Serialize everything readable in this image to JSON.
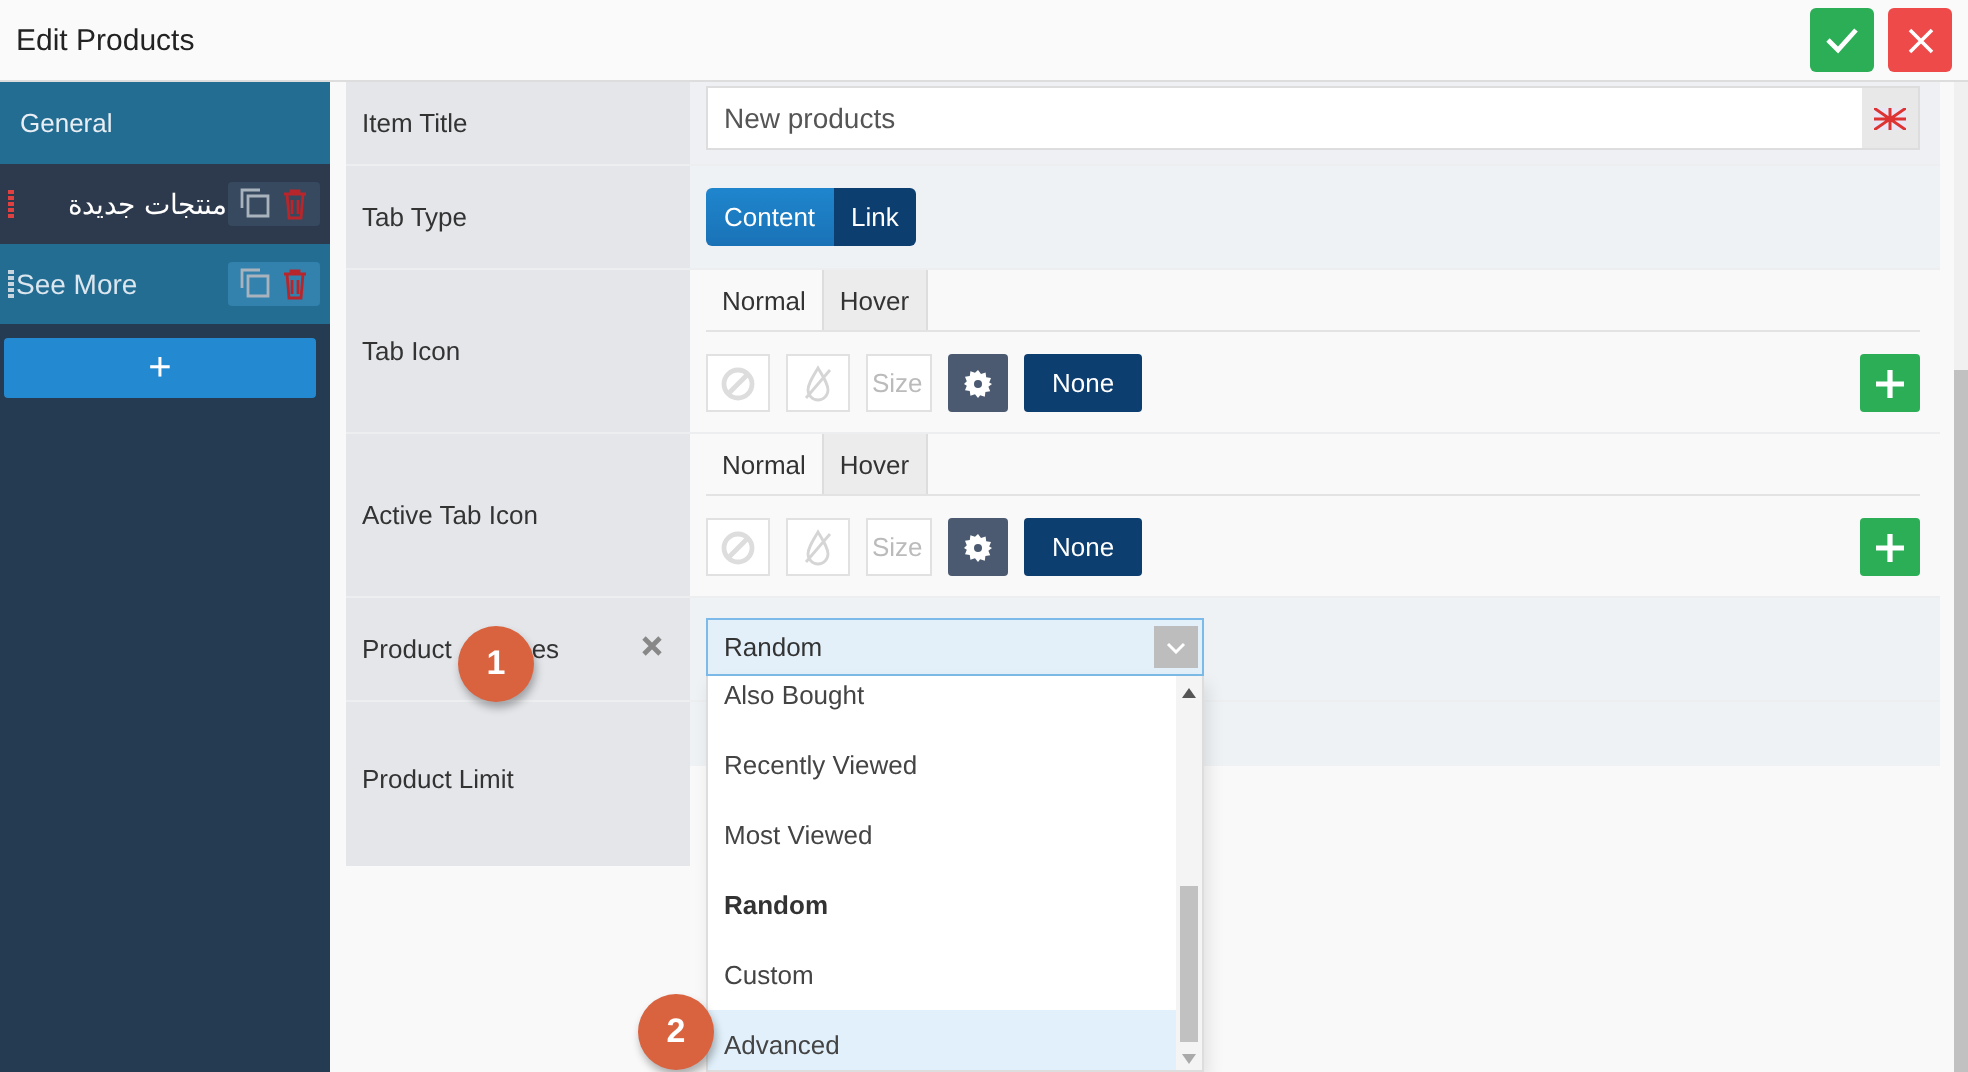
{
  "window": {
    "title": "Edit Products"
  },
  "header_buttons": [
    {
      "kind": "save"
    },
    {
      "kind": "close"
    }
  ],
  "sidebar": {
    "heading": "General",
    "items": [
      {
        "label": "منتجات جديدة",
        "selected": true
      },
      {
        "label": "See More",
        "selected": false
      }
    ],
    "add_label": "+"
  },
  "form": {
    "item_title": {
      "label": "Item Title",
      "value": "New products"
    },
    "tab_type": {
      "label": "Tab Type",
      "options": [
        {
          "label": "Content",
          "selected": true
        },
        {
          "label": "Link",
          "selected": false
        }
      ]
    },
    "icon_rows": [
      {
        "label": "Tab Icon",
        "tabs": [
          {
            "label": "Normal",
            "selected": true
          },
          {
            "label": "Hover",
            "selected": false
          }
        ],
        "size_placeholder": "Size",
        "none_label": "None"
      },
      {
        "label": "Active Tab Icon",
        "tabs": [
          {
            "label": "Normal",
            "selected": true
          },
          {
            "label": "Hover",
            "selected": false
          }
        ],
        "size_placeholder": "Size",
        "none_label": "None"
      }
    ],
    "product_types": {
      "label_parts": [
        "Product",
        "es"
      ],
      "value": "Random",
      "options": [
        {
          "label": "Also Bought",
          "selected": false,
          "highlighted": false
        },
        {
          "label": "Recently Viewed",
          "selected": false,
          "highlighted": false
        },
        {
          "label": "Most Viewed",
          "selected": false,
          "highlighted": false
        },
        {
          "label": "Random",
          "selected": true,
          "highlighted": false
        },
        {
          "label": "Custom",
          "selected": false,
          "highlighted": false
        },
        {
          "label": "Advanced",
          "selected": false,
          "highlighted": true
        }
      ]
    },
    "product_limit": {
      "label": "Product Limit"
    }
  },
  "callouts": [
    "1",
    "2"
  ]
}
